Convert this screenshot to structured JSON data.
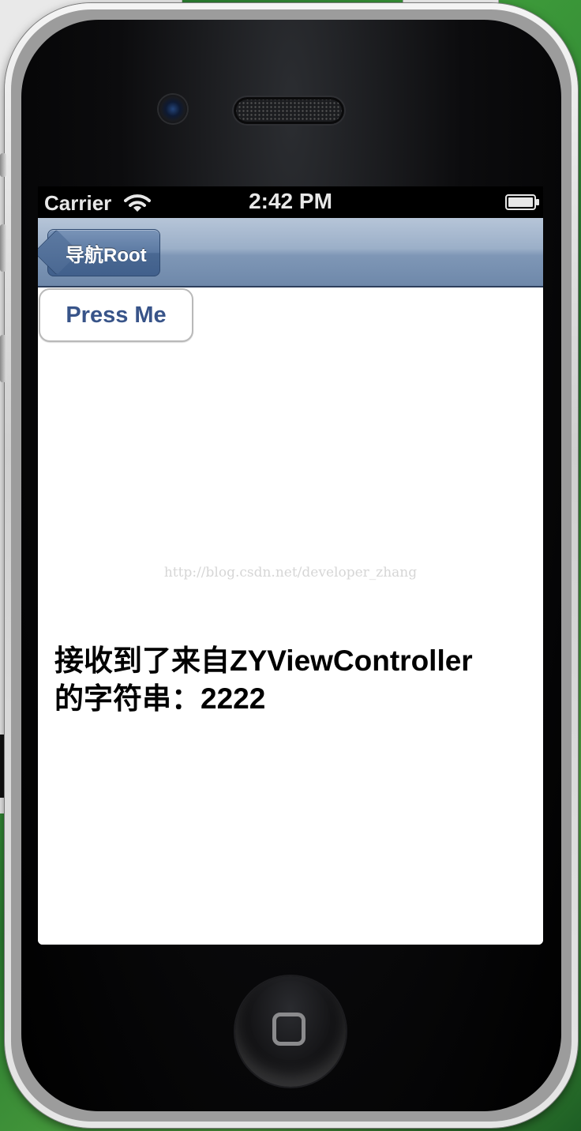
{
  "status_bar": {
    "carrier": "Carrier",
    "time": "2:42 PM",
    "wifi_icon": "wifi-icon",
    "battery_icon": "battery-icon"
  },
  "nav_bar": {
    "back_label": "导航Root",
    "back_icon": "back-arrow-icon",
    "colors": {
      "bar": "#8ea3bf",
      "button": "#4d6a93"
    }
  },
  "content": {
    "press_button_label": "Press Me",
    "watermark": "http://blog.csdn.net/developer_zhang",
    "result_text": "接收到了来自ZYViewController\n的字符串：2222",
    "colors": {
      "button_text": "#385489"
    }
  },
  "device": {
    "home_button_icon": "home-square-icon"
  }
}
